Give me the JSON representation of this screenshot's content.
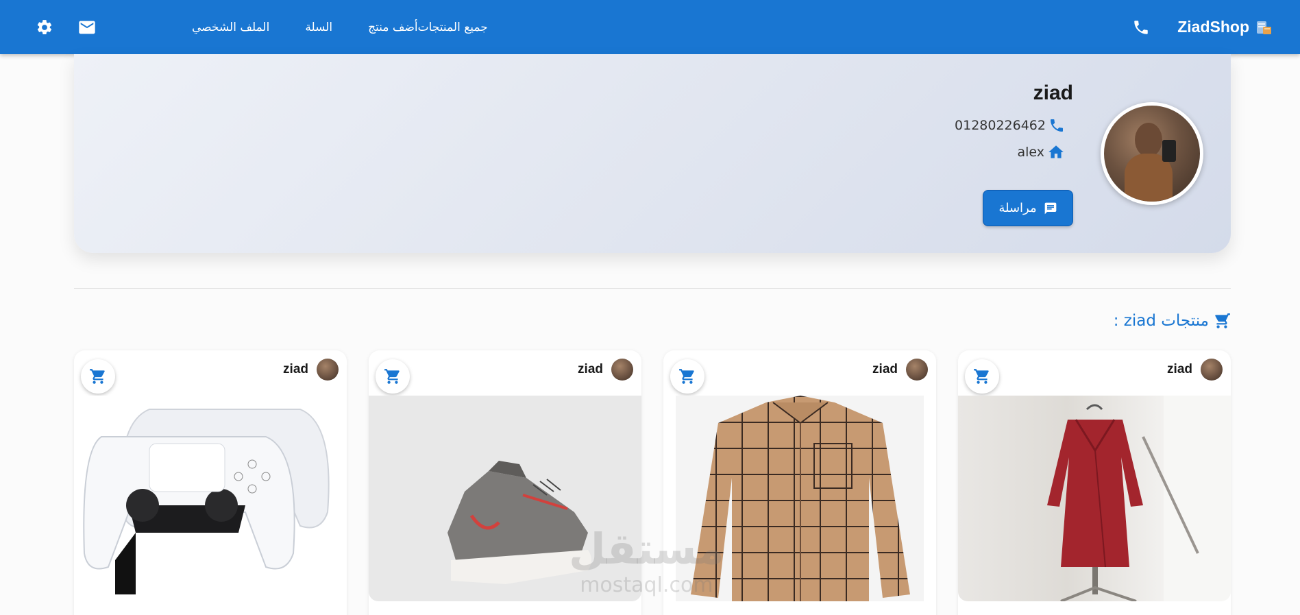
{
  "navbar": {
    "brand": "ZiadShop",
    "links": [
      "جميع المنتجات",
      "أضف منتج",
      "السلة",
      "الملف الشخصي"
    ]
  },
  "profile": {
    "name": "ziad",
    "phone": "01280226462",
    "address": "alex",
    "message_label": "مراسلة"
  },
  "section": {
    "title": "منتجات ziad :"
  },
  "products": [
    {
      "seller": "ziad",
      "image": "red-dress"
    },
    {
      "seller": "ziad",
      "image": "plaid-shirt"
    },
    {
      "seller": "ziad",
      "image": "puma-sneaker"
    },
    {
      "seller": "ziad",
      "image": "ps5-controllers"
    }
  ],
  "watermark": {
    "arabic": "مستقل",
    "english": "mostaql.com"
  },
  "colors": {
    "primary": "#1976d2",
    "background": "#fbfbfb"
  }
}
